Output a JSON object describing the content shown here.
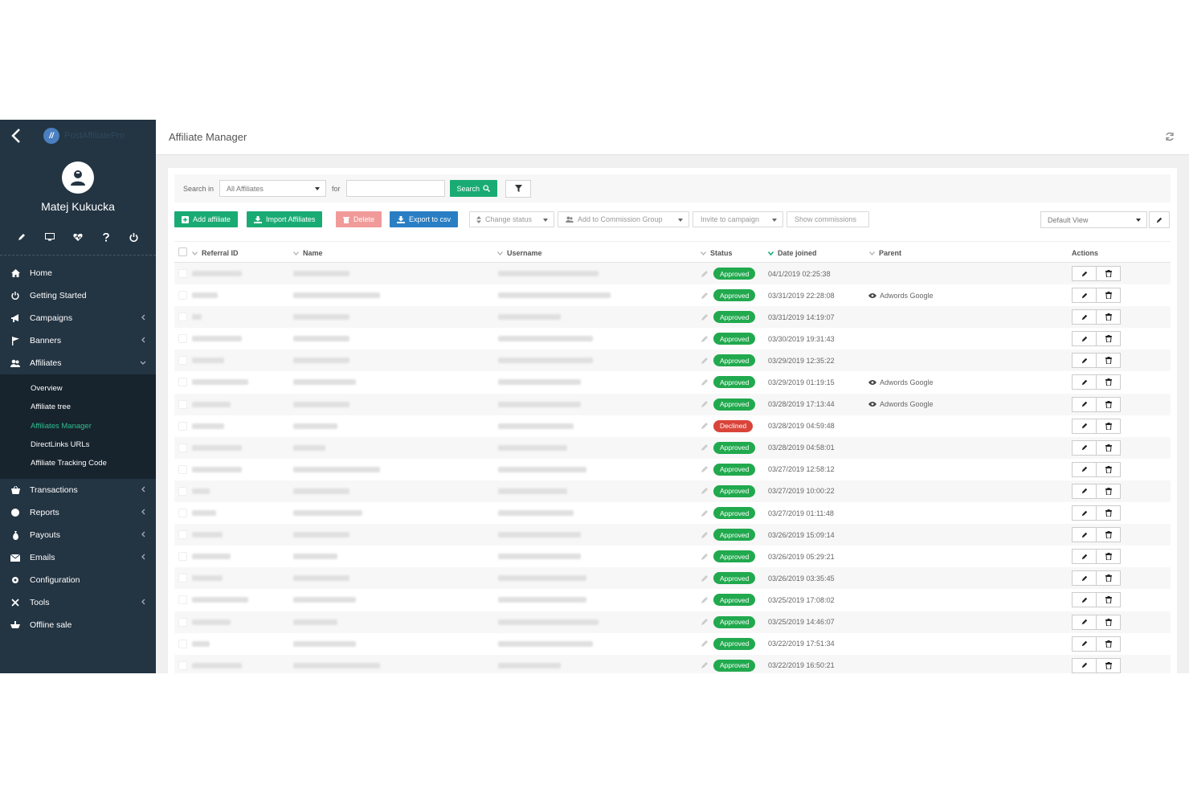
{
  "user": {
    "name": "Matej Kukucka"
  },
  "logo": {
    "text": "PostAffiliatePro"
  },
  "page": {
    "title": "Affiliate Manager"
  },
  "nav": {
    "items": [
      {
        "label": "Home",
        "icon": "home-icon"
      },
      {
        "label": "Getting Started",
        "icon": "power-icon"
      },
      {
        "label": "Campaigns",
        "icon": "megaphone-icon",
        "chevron": true
      },
      {
        "label": "Banners",
        "icon": "flag-icon",
        "chevron": true
      },
      {
        "label": "Affiliates",
        "icon": "users-icon",
        "chevron": true
      }
    ],
    "sub_items": [
      {
        "label": "Overview"
      },
      {
        "label": "Affiliate tree"
      },
      {
        "label": "Affiliates Manager",
        "active": true
      },
      {
        "label": "DirectLinks URLs"
      },
      {
        "label": "Affiliate Tracking Code"
      }
    ],
    "items_after": [
      {
        "label": "Transactions",
        "icon": "basket-icon",
        "chevron": true
      },
      {
        "label": "Reports",
        "icon": "chart-icon",
        "chevron": true
      },
      {
        "label": "Payouts",
        "icon": "money-icon",
        "chevron": true
      },
      {
        "label": "Emails",
        "icon": "envelope-icon",
        "chevron": true
      },
      {
        "label": "Configuration",
        "icon": "gear-icon"
      },
      {
        "label": "Tools",
        "icon": "tools-icon",
        "chevron": true
      },
      {
        "label": "Offline sale",
        "icon": "cart-icon"
      }
    ]
  },
  "search": {
    "label": "Search in",
    "scope_value": "All Affiliates",
    "for_label": "for",
    "query_value": "",
    "search_button": "Search"
  },
  "toolbar": {
    "add_affiliate": "Add affiliate",
    "import_affiliates": "Import Affiliates",
    "delete": "Delete",
    "export_csv": "Export to csv",
    "change_status": "Change status",
    "add_commission_group": "Add to Commission Group",
    "invite_campaign": "Invite to campaign",
    "show_commissions": "Show commissions",
    "view_select": "Default View"
  },
  "table": {
    "headers": {
      "referral_id": "Referral ID",
      "name": "Name",
      "username": "Username",
      "status": "Status",
      "date_joined": "Date joined",
      "parent": "Parent",
      "actions": "Actions"
    },
    "rows": [
      {
        "status": "Approved",
        "date": "04/1/2019 02:25:38",
        "parent": ""
      },
      {
        "status": "Approved",
        "date": "03/31/2019 22:28:08",
        "parent": "Adwords Google"
      },
      {
        "status": "Approved",
        "date": "03/31/2019 14:19:07",
        "parent": ""
      },
      {
        "status": "Approved",
        "date": "03/30/2019 19:31:43",
        "parent": ""
      },
      {
        "status": "Approved",
        "date": "03/29/2019 12:35:22",
        "parent": ""
      },
      {
        "status": "Approved",
        "date": "03/29/2019 01:19:15",
        "parent": "Adwords Google"
      },
      {
        "status": "Approved",
        "date": "03/28/2019 17:13:44",
        "parent": "Adwords Google"
      },
      {
        "status": "Declined",
        "date": "03/28/2019 04:59:48",
        "parent": ""
      },
      {
        "status": "Approved",
        "date": "03/28/2019 04:58:01",
        "parent": ""
      },
      {
        "status": "Approved",
        "date": "03/27/2019 12:58:12",
        "parent": ""
      },
      {
        "status": "Approved",
        "date": "03/27/2019 10:00:22",
        "parent": ""
      },
      {
        "status": "Approved",
        "date": "03/27/2019 01:11:48",
        "parent": ""
      },
      {
        "status": "Approved",
        "date": "03/26/2019 15:09:14",
        "parent": ""
      },
      {
        "status": "Approved",
        "date": "03/26/2019 05:29:21",
        "parent": ""
      },
      {
        "status": "Approved",
        "date": "03/26/2019 03:35:45",
        "parent": ""
      },
      {
        "status": "Approved",
        "date": "03/25/2019 17:08:02",
        "parent": ""
      },
      {
        "status": "Approved",
        "date": "03/25/2019 14:46:07",
        "parent": ""
      },
      {
        "status": "Approved",
        "date": "03/22/2019 17:51:34",
        "parent": ""
      },
      {
        "status": "Approved",
        "date": "03/22/2019 16:50:21",
        "parent": ""
      }
    ]
  },
  "colors": {
    "sidebar": "#233442",
    "accent_green": "#1aab74",
    "approved": "#21a94e",
    "declined": "#d9443a",
    "export_blue": "#2a7ec4"
  }
}
